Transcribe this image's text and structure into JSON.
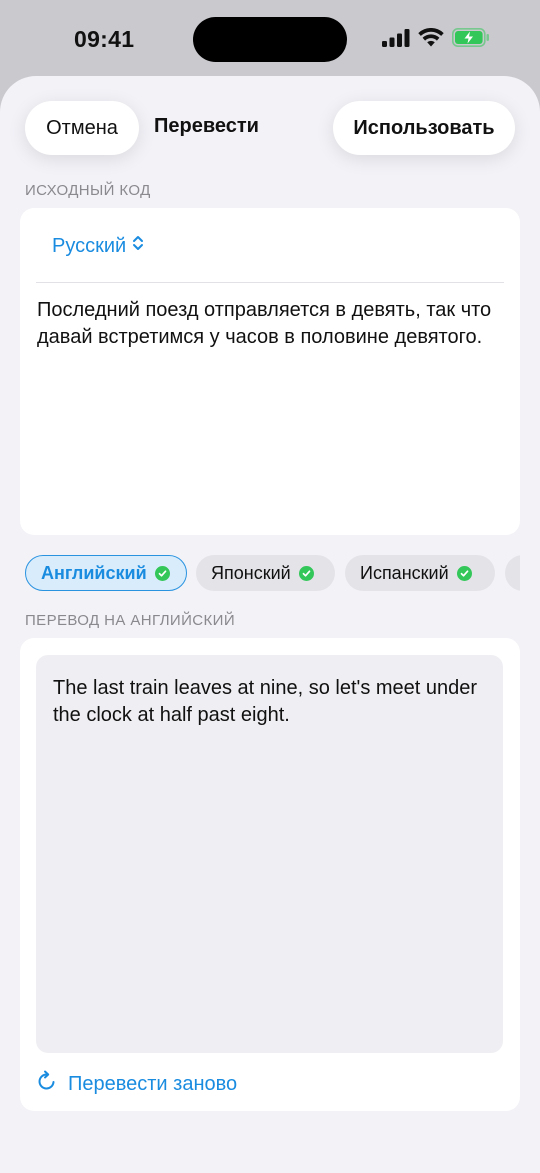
{
  "status_bar": {
    "time": "09:41"
  },
  "header": {
    "cancel_label": "Отмена",
    "title": "Перевести",
    "use_label": "Использовать"
  },
  "source": {
    "section_label": "ИСХОДНЫЙ КОД",
    "language": "Русский",
    "text": "Последний поезд отправляется в девять, так что давай встретимся у часов в половине девятого."
  },
  "languages": [
    {
      "label": "Английский",
      "selected": true,
      "downloaded": true
    },
    {
      "label": "Японский",
      "selected": false,
      "downloaded": true
    },
    {
      "label": "Испанский",
      "selected": false,
      "downloaded": true
    }
  ],
  "target": {
    "section_label": "ПЕРЕВОД НА АНГЛИЙСКИЙ",
    "text": "The last train leaves at nine, so let's meet under the clock at half past eight.",
    "retranslate_label": "Перевести заново"
  },
  "colors": {
    "accent": "#1a8ce0",
    "check": "#33c759",
    "battery": "#33c759"
  },
  "icons": {
    "signal": "cellular-signal-icon",
    "wifi": "wifi-icon",
    "battery": "battery-charging-icon",
    "chevron": "chevron-up-down-icon",
    "check": "checkmark-circle-icon",
    "retranslate": "arrow-clockwise-icon"
  }
}
